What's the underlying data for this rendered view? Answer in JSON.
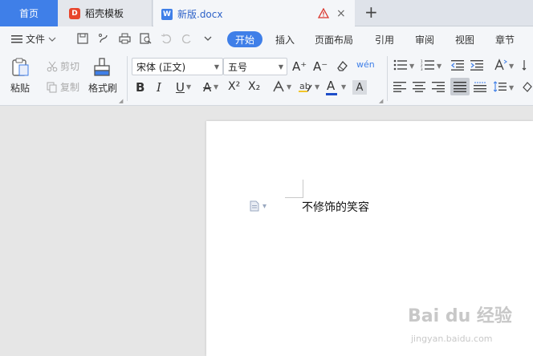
{
  "tabs": {
    "home": "首页",
    "daoke": "稻壳模板",
    "doc": "新版.docx",
    "daoke_logo": "D",
    "doc_logo": "W",
    "add": "+",
    "close": "×"
  },
  "menu": {
    "file": "文件",
    "ribbon_tabs": [
      "开始",
      "插入",
      "页面布局",
      "引用",
      "审阅",
      "视图",
      "章节"
    ],
    "active_tab": "开始"
  },
  "ribbon": {
    "paste": "粘贴",
    "cut": "剪切",
    "copy": "复制",
    "format_painter": "格式刷",
    "font_name": "宋体 (正文)",
    "font_size": "五号",
    "bold": "B",
    "italic": "I",
    "underline": "U",
    "strike": "A",
    "superscript": "X²",
    "subscript": "X₂",
    "font_color": "A",
    "grow": "A⁺",
    "shrink": "A⁻",
    "phonetic": "wén",
    "char_shade": "A"
  },
  "document": {
    "text": "不修饰的笑容"
  },
  "watermark": {
    "brand": "Bai du 经验",
    "url": "jingyan.baidu.com"
  },
  "colors": {
    "accent": "#3f7fe8",
    "font_color_bar": "#1e4ec9"
  }
}
